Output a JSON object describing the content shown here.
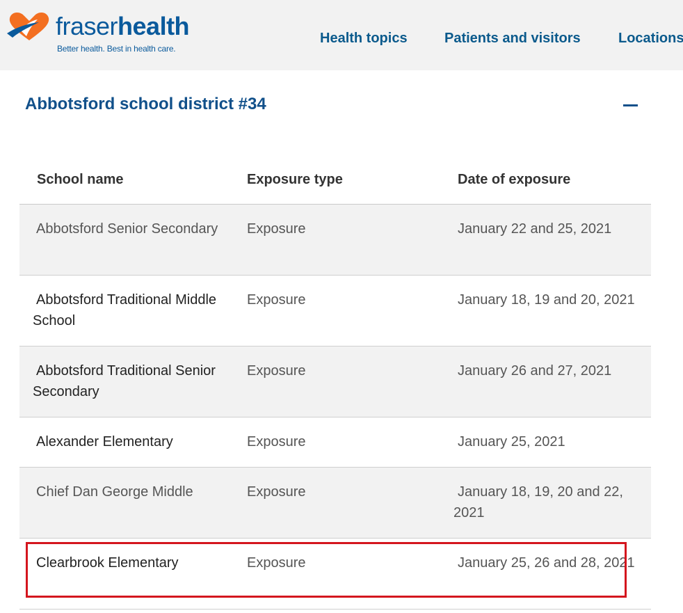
{
  "header": {
    "brand_light": "fraser",
    "brand_bold": "health",
    "tagline": "Better health. Best in health care.",
    "nav": [
      "Health topics",
      "Patients and visitors",
      "Locations"
    ]
  },
  "section": {
    "title": "Abbotsford school district #34",
    "collapse_icon": "minus"
  },
  "table": {
    "headers": [
      "School name",
      "Exposure type",
      "Date of exposure"
    ],
    "rows": [
      {
        "school": "Abbotsford Senior Secondary",
        "type": "Exposure",
        "date": "January 22 and 25, 2021"
      },
      {
        "school": "Abbotsford Traditional Middle School",
        "type": "Exposure",
        "date": "January 18, 19 and 20, 2021"
      },
      {
        "school": "Abbotsford Traditional Senior Secondary",
        "type": "Exposure",
        "date": "January 26 and 27, 2021"
      },
      {
        "school": "Alexander Elementary",
        "type": "Exposure",
        "date": "January 25, 2021"
      },
      {
        "school": "Chief Dan George Middle",
        "type": "Exposure",
        "date": "January 18, 19, 20 and 22, 2021"
      },
      {
        "school": "Clearbrook Elementary",
        "type": "Exposure",
        "date": "January 25, 26 and 28, 2021"
      }
    ]
  },
  "colors": {
    "brand": "#0a5a9c",
    "accent_orange": "#f36f21",
    "highlight": "#d4161e"
  }
}
